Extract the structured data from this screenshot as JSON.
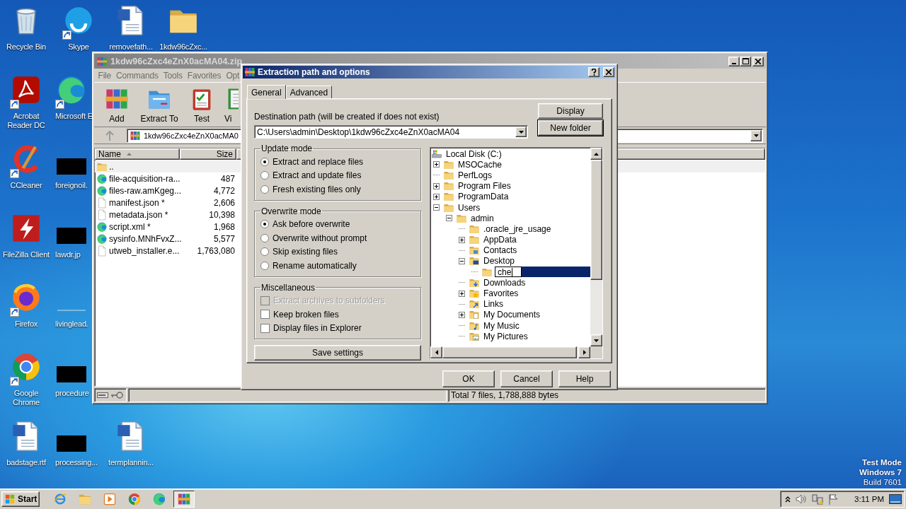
{
  "desktop": {
    "icon_rows": [
      [
        {
          "label": "Recycle Bin",
          "kind": "recycle",
          "shortcut": false
        },
        {
          "label": "Skype",
          "kind": "skype",
          "shortcut": true
        },
        {
          "label": "removefath...",
          "kind": "word",
          "shortcut": false
        },
        {
          "label": "1kdw96cZxc...",
          "kind": "folder",
          "shortcut": false
        }
      ],
      [
        {
          "label": "Acrobat Reader DC",
          "kind": "acrobat",
          "shortcut": true
        },
        {
          "label": "Microsoft E",
          "kind": "edge",
          "shortcut": true
        }
      ],
      [
        {
          "label": "CCleaner",
          "kind": "ccleaner",
          "shortcut": true
        },
        {
          "label": "foreignoil.",
          "kind": "thumb",
          "shortcut": false
        }
      ],
      [
        {
          "label": "FileZilla Client",
          "kind": "filezilla",
          "shortcut": false
        },
        {
          "label": "lawdr.jp",
          "kind": "thumb",
          "shortcut": false
        }
      ],
      [
        {
          "label": "Firefox",
          "kind": "firefox",
          "shortcut": true
        },
        {
          "label": "livinglead.",
          "kind": "faint",
          "shortcut": false
        }
      ],
      [
        {
          "label": "Google Chrome",
          "kind": "chrome",
          "shortcut": true
        },
        {
          "label": "procedure",
          "kind": "thumb",
          "shortcut": false
        }
      ],
      [
        {
          "label": "badstage.rtf",
          "kind": "word",
          "shortcut": false
        },
        {
          "label": "processing...",
          "kind": "thumb",
          "shortcut": false
        },
        {
          "label": "termplannin...",
          "kind": "word",
          "shortcut": false
        }
      ]
    ],
    "os_notice": [
      "Test Mode",
      "Windows 7",
      "Build 7601"
    ]
  },
  "archive_window": {
    "title": "1kdw96cZxc4eZnX0acMA04.zip",
    "active": false,
    "menu": [
      "File",
      "Commands",
      "Tools",
      "Favorites",
      "Opt"
    ],
    "toolbar": [
      {
        "label": "Add",
        "kind": "add"
      },
      {
        "label": "Extract To",
        "kind": "extract"
      },
      {
        "label": "Test",
        "kind": "test"
      },
      {
        "label": "Vi",
        "kind": "view"
      }
    ],
    "address": "1kdw96cZxc4eZnX0acMA0",
    "columns": [
      {
        "label": "Name",
        "sorted": true
      },
      {
        "label": "Size",
        "sorted": false
      }
    ],
    "files": [
      {
        "name": "..",
        "kind": "up"
      },
      {
        "name": "file-acquisition-ra...",
        "size": "487",
        "kind": "edge"
      },
      {
        "name": "files-raw.amKgeg...",
        "size": "4,772",
        "kind": "edge"
      },
      {
        "name": "manifest.json *",
        "size": "2,606",
        "kind": "file"
      },
      {
        "name": "metadata.json *",
        "size": "10,398",
        "kind": "file"
      },
      {
        "name": "script.xml *",
        "size": "1,968",
        "kind": "edge"
      },
      {
        "name": "sysinfo.MNhFvxZ...",
        "size": "5,577",
        "kind": "edge"
      },
      {
        "name": "utweb_installer.e...",
        "size": "1,763,080",
        "kind": "file"
      }
    ],
    "status": "Total 7 files, 1,788,888 bytes"
  },
  "dialog": {
    "title": "Extraction path and options",
    "active": true,
    "tabs": [
      {
        "label": "General",
        "selected": true
      },
      {
        "label": "Advanced",
        "selected": false
      }
    ],
    "destination_label": "Destination path (will be created if does not exist)",
    "destination_path": "C:\\Users\\admin\\Desktop\\1kdw96cZxc4eZnX0acMA04",
    "side_buttons": [
      {
        "label": "Display",
        "default": false
      },
      {
        "label": "New folder",
        "default": true
      }
    ],
    "groups": [
      {
        "title": "Update mode",
        "kind": "radio",
        "options": [
          {
            "label": "Extract and replace files",
            "selected": true
          },
          {
            "label": "Extract and update files",
            "selected": false
          },
          {
            "label": "Fresh existing files only",
            "selected": false
          }
        ]
      },
      {
        "title": "Overwrite mode",
        "kind": "radio",
        "options": [
          {
            "label": "Ask before overwrite",
            "selected": true
          },
          {
            "label": "Overwrite without prompt",
            "selected": false
          },
          {
            "label": "Skip existing files",
            "selected": false
          },
          {
            "label": "Rename automatically",
            "selected": false
          }
        ]
      },
      {
        "title": "Miscellaneous",
        "kind": "checkbox",
        "options": [
          {
            "label": "Extract archives to subfolders",
            "checked": false,
            "disabled": true
          },
          {
            "label": "Keep broken files",
            "checked": false,
            "disabled": false
          },
          {
            "label": "Display files in Explorer",
            "checked": false,
            "disabled": false
          }
        ]
      }
    ],
    "save_button": "Save settings",
    "tree": [
      {
        "label": "Local Disk (C:)",
        "kind": "drive",
        "expandable": false,
        "selected": false,
        "editing": false,
        "children": [
          {
            "label": "MSOCache",
            "kind": "folder",
            "expandable": true,
            "expanded": false,
            "selected": false,
            "editing": false
          },
          {
            "label": "PerfLogs",
            "kind": "folder",
            "expandable": false,
            "selected": false,
            "editing": false
          },
          {
            "label": "Program Files",
            "kind": "folder",
            "expandable": true,
            "expanded": false,
            "selected": false,
            "editing": false
          },
          {
            "label": "ProgramData",
            "kind": "folder",
            "expandable": true,
            "expanded": false,
            "selected": false,
            "editing": false
          },
          {
            "label": "Users",
            "kind": "folder",
            "expandable": true,
            "expanded": true,
            "selected": false,
            "editing": false,
            "children": [
              {
                "label": "admin",
                "kind": "folder",
                "expandable": true,
                "expanded": true,
                "selected": false,
                "editing": false,
                "children": [
                  {
                    "label": ".oracle_jre_usage",
                    "kind": "folder",
                    "expandable": false,
                    "selected": false,
                    "editing": false
                  },
                  {
                    "label": "AppData",
                    "kind": "folder",
                    "expandable": true,
                    "expanded": false,
                    "selected": false,
                    "editing": false
                  },
                  {
                    "label": "Contacts",
                    "kind": "contacts",
                    "expandable": false,
                    "selected": false,
                    "editing": false
                  },
                  {
                    "label": "Desktop",
                    "kind": "desktop",
                    "expandable": true,
                    "expanded": true,
                    "selected": false,
                    "editing": false,
                    "children": [
                      {
                        "label": "che",
                        "kind": "folder",
                        "expandable": false,
                        "selected": true,
                        "editing": true
                      }
                    ]
                  },
                  {
                    "label": "Downloads",
                    "kind": "downloads",
                    "expandable": false,
                    "selected": false,
                    "editing": false
                  },
                  {
                    "label": "Favorites",
                    "kind": "favorites",
                    "expandable": true,
                    "expanded": false,
                    "selected": false,
                    "editing": false
                  },
                  {
                    "label": "Links",
                    "kind": "links",
                    "expandable": false,
                    "selected": false,
                    "editing": false
                  },
                  {
                    "label": "My Documents",
                    "kind": "documents",
                    "expandable": true,
                    "expanded": false,
                    "selected": false,
                    "editing": false
                  },
                  {
                    "label": "My Music",
                    "kind": "music",
                    "expandable": false,
                    "selected": false,
                    "editing": false
                  },
                  {
                    "label": "My Pictures",
                    "kind": "pictures",
                    "expandable": false,
                    "selected": false,
                    "editing": false
                  }
                ]
              }
            ]
          }
        ]
      }
    ],
    "buttons": [
      "OK",
      "Cancel",
      "Help"
    ]
  },
  "taskbar": {
    "start": "Start",
    "tasks": [
      {
        "kind": "ie",
        "active": false
      },
      {
        "kind": "explorer",
        "active": false
      },
      {
        "kind": "media",
        "active": false
      },
      {
        "kind": "chrome",
        "active": false
      },
      {
        "kind": "edge",
        "active": false
      },
      {
        "kind": "winrar",
        "active": true
      }
    ],
    "clock": "3:11 PM"
  }
}
